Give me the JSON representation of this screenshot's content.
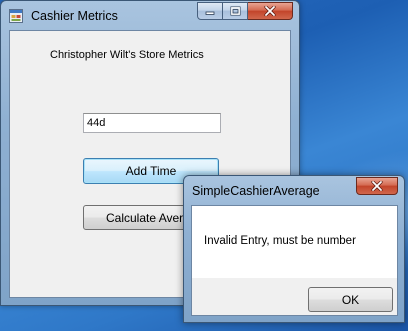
{
  "main_window": {
    "title": "Cashier Metrics",
    "store_label": "Christopher Wilt's Store Metrics",
    "time_input_value": "44d",
    "add_time_label": "Add Time",
    "calculate_label": "Calculate Average"
  },
  "message_box": {
    "title": "SimpleCashierAverage",
    "message": "Invalid Entry, must be number",
    "ok_label": "OK"
  },
  "icons": {
    "app": "form-app-icon",
    "minimize": "minimize-icon",
    "maximize": "maximize-icon",
    "close": "close-icon"
  },
  "colors": {
    "title_bar": "#a9c4df",
    "close_button": "#c2442a",
    "client_background": "#f0f0f0",
    "focused_button_border": "#3c7fb1",
    "desktop": "#2a6cc0"
  }
}
